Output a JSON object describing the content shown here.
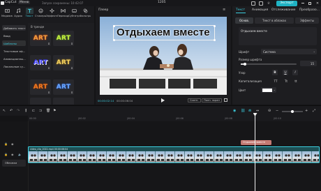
{
  "app": {
    "name": "CapCut",
    "menu_label": "Меню",
    "draft_title": "Запуск сохранены: 10:42:07",
    "timecode_center": "1205",
    "export_label": "Экспорт"
  },
  "toolbar": {
    "tools": [
      {
        "label": "Медиаматериалы",
        "icon": "media-icon"
      },
      {
        "label": "Аудио",
        "icon": "audio-icon"
      },
      {
        "label": "Текст",
        "icon": "text-icon",
        "active": true
      },
      {
        "label": "Стикеры",
        "icon": "sticker-icon"
      },
      {
        "label": "Эффекты",
        "icon": "effects-icon"
      },
      {
        "label": "Переходы",
        "icon": "transition-icon"
      },
      {
        "label": "Субтитры",
        "icon": "subtitles-icon"
      },
      {
        "label": "Фильтры",
        "icon": "filter-icon"
      }
    ]
  },
  "sidebar": {
    "add_text_label": "Добавить текст",
    "items": [
      {
        "label": "Ввод"
      },
      {
        "label": "Шаблоны",
        "active": true
      },
      {
        "label": "Текстовые эф..."
      },
      {
        "label": "Анимационны..."
      },
      {
        "label": "Локальные су..."
      }
    ]
  },
  "templates": {
    "header": "В тренде",
    "items": [
      {
        "text": "ART",
        "color": "#f0a040",
        "bg": "#2a2420"
      },
      {
        "text": "ART",
        "color": "#b5e040",
        "bg": "#222a1e"
      },
      {
        "text": "ART",
        "color": "#3a3aff",
        "bg": "#1e1e2c"
      },
      {
        "text": "ART",
        "color": "#f0d060",
        "bg": "#2a281e"
      },
      {
        "text": "ART",
        "color": "#f07a20",
        "bg": "#2c2018"
      },
      {
        "text": "ART",
        "color": "#5a9cff",
        "bg": "#1e2230"
      }
    ]
  },
  "player": {
    "title": "Плеер",
    "overlay_text": "Отдыхаем вместе",
    "current_time": "00:00:02:14",
    "total_time": "00:00:06:04",
    "ratio_label": "Соотн.",
    "full_label": "Полн. экран"
  },
  "right_panel": {
    "tabs": [
      "Текст",
      "Анимация",
      "Отслеживание",
      "Преобразо..."
    ],
    "segments": [
      "Основ.",
      "Текст в облаках",
      "Эффекты"
    ],
    "text_value": "Отдыхаем вместе",
    "font_label": "Шрифт",
    "font_value": "Система",
    "size_label": "Размер шрифта",
    "size_value": "15",
    "style_label": "Узор",
    "style_buttons": [
      "B",
      "U",
      "I"
    ],
    "case_label": "Капитализация",
    "case_buttons": [
      "TT",
      "Tt",
      "tt"
    ],
    "color_label": "Цвет",
    "color_value": "#ffffff"
  },
  "timeline": {
    "ruler_labels": [
      "00:00",
      "|00:02",
      "|00:04",
      "|00:06",
      "|00:08",
      "|00:10"
    ],
    "text_clip_label": "Отдыхаем вместе",
    "video_clip_label": "video_clip_2022.mp4  00:00:06:04",
    "cover_label": "Обложка"
  }
}
